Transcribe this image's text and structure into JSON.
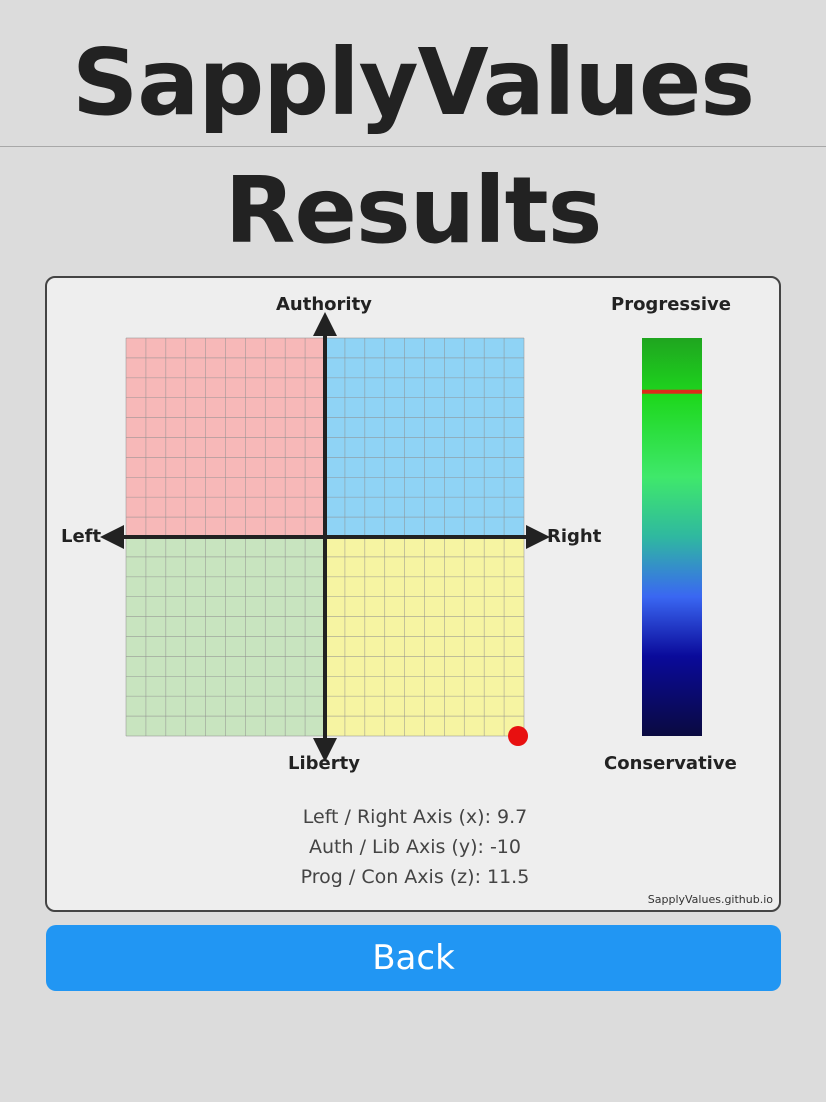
{
  "page": {
    "title_line1": "SapplyValues",
    "title_line2": "Results"
  },
  "chart_data": {
    "type": "scatter",
    "axes": {
      "top": "Authority",
      "bottom": "Liberty",
      "left": "Left",
      "right": "Right"
    },
    "xlim": [
      -10,
      10
    ],
    "ylim": [
      -10,
      10
    ],
    "grid": true,
    "points": [
      {
        "x": 9.7,
        "y": -10
      }
    ],
    "quadrant_colors": {
      "top_left": "#f7b8b8",
      "top_right": "#8fd3f5",
      "bottom_left": "#c8e4bf",
      "bottom_right": "#f6f4a2"
    },
    "point_color": "#e81010",
    "gradient_bar": {
      "top_label": "Progressive",
      "bottom_label": "Conservative",
      "zlim": [
        -10,
        10
      ],
      "value": 11.5,
      "marker_color": "#dd2a1a"
    }
  },
  "results": {
    "x_line": "Left / Right Axis (x): 9.7",
    "y_line": "Auth / Lib Axis (y): -10",
    "z_line": "Prog / Con Axis (z): 11.5"
  },
  "footer": "SapplyValues.github.io",
  "back_button": "Back"
}
